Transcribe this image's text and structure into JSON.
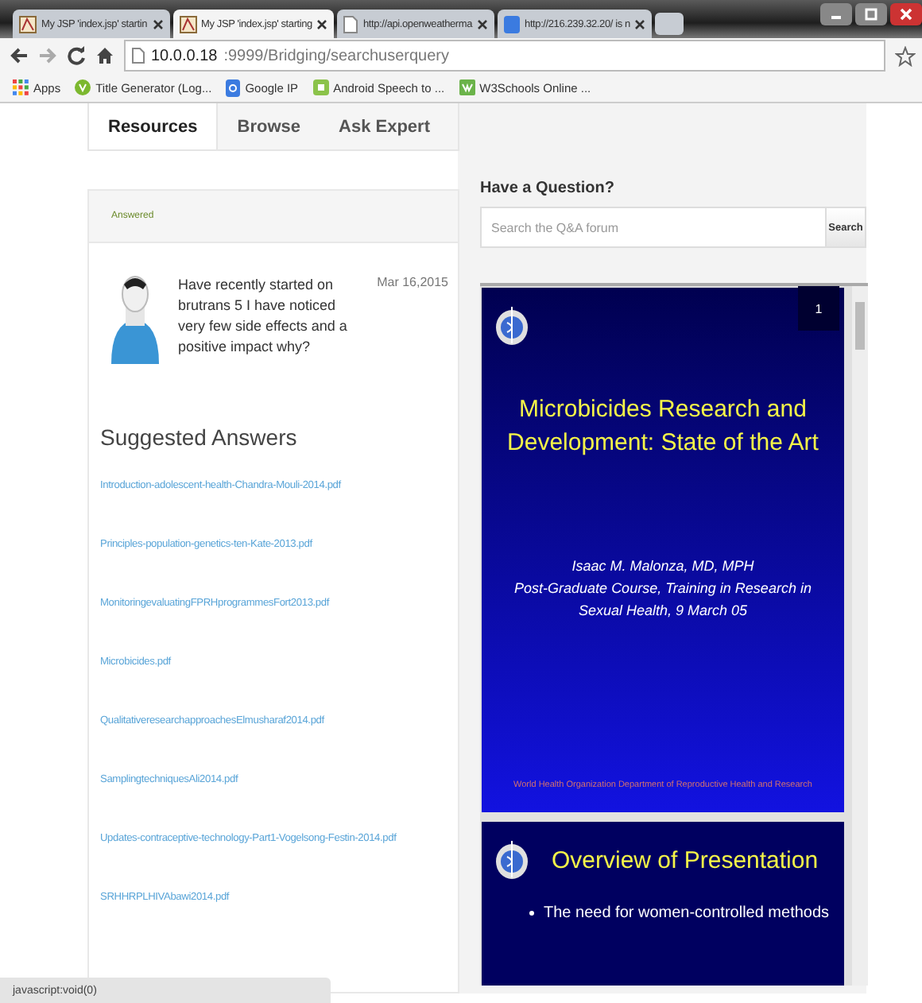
{
  "browser": {
    "tabs": [
      {
        "title": "My JSP 'index.jsp' startin",
        "selected": false,
        "kind": "page"
      },
      {
        "title": "My JSP 'index.jsp' starting",
        "selected": true,
        "kind": "page"
      },
      {
        "title": "http://api.openweatherma",
        "selected": false,
        "kind": "blank"
      },
      {
        "title": "http://216.239.32.20/ is n",
        "selected": false,
        "kind": "google"
      }
    ],
    "address": {
      "host": "10.0.0.18",
      "path": ":9999/Bridging/searchuserquery"
    },
    "bookmarks": [
      {
        "label": "Apps",
        "kind": "apps"
      },
      {
        "label": "Title Generator (Log...",
        "kind": "shield"
      },
      {
        "label": "Google IP",
        "kind": "google"
      },
      {
        "label": "Android Speech to ...",
        "kind": "android"
      },
      {
        "label": "W3Schools Online ...",
        "kind": "w3"
      }
    ]
  },
  "nav_tabs": [
    {
      "label": "Resources",
      "selected": true
    },
    {
      "label": "Browse",
      "selected": false
    },
    {
      "label": "Ask Expert",
      "selected": false
    }
  ],
  "question": {
    "status": "Answered",
    "text": "Have recently started on brutrans 5 I have noticed very few side effects and a positive impact why?",
    "date": "Mar 16,2015"
  },
  "suggested": {
    "heading": "Suggested Answers",
    "links": [
      "Introduction-adolescent-health-Chandra-Mouli-2014.pdf",
      "Principles-population-genetics-ten-Kate-2013.pdf",
      "MonitoringevaluatingFPRHprogrammesFort2013.pdf",
      "Microbicides.pdf",
      "QualitativeresearchapproachesElmusharaf2014.pdf",
      "SamplingtechniquesAli2014.pdf",
      "Updates-contraceptive-technology-Part1-Vogelsong-Festin-2014.pdf",
      "SRHHRPLHIVAbawi2014.pdf"
    ]
  },
  "sidebar": {
    "heading": "Have a Question?",
    "search": {
      "placeholder": "Search the Q&A forum",
      "button": "Search"
    }
  },
  "viewer": {
    "page_number": "1",
    "slides": [
      {
        "kind": "title",
        "title": "Microbicides Research and Development: State of the Art",
        "subtitle": "Isaac M. Malonza, MD, MPH\nPost-Graduate Course, Training in Research in Sexual Health, 9 March 05",
        "footer": "World Health Organization Department of Reproductive Health and Research"
      },
      {
        "kind": "bullets",
        "title": "Overview of Presentation",
        "bullets": [
          "The need for women-controlled methods"
        ]
      }
    ]
  },
  "status_bar": "javascript:void(0)"
}
